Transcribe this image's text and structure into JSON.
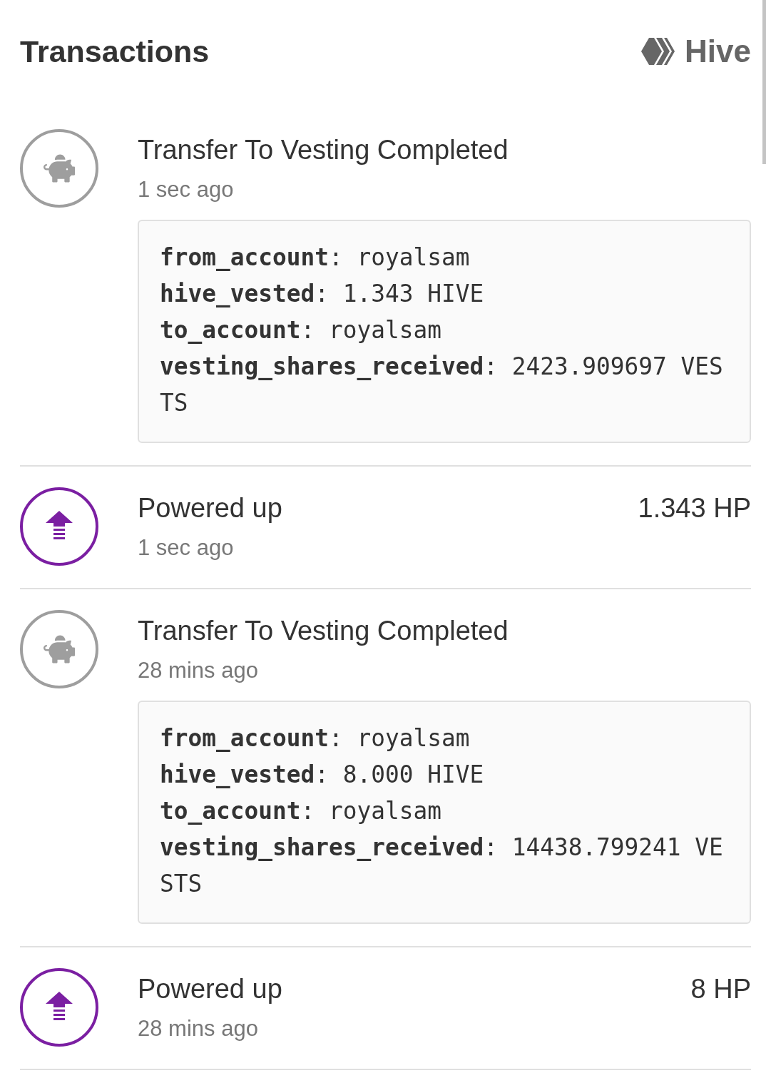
{
  "header": {
    "title": "Transactions",
    "brand": "Hive"
  },
  "transactions": [
    {
      "kind": "vesting",
      "title": "Transfer To Vesting Completed",
      "time": "1 sec ago",
      "details": [
        "**from_account**: royalsam",
        "**hive_vested**: 1.343 HIVE",
        "**to_account**: royalsam",
        "**vesting_shares_received**: 2423.909697 VESTS"
      ]
    },
    {
      "kind": "power_up",
      "title": "Powered up",
      "time": "1 sec ago",
      "amount": "1.343 HP"
    },
    {
      "kind": "vesting",
      "title": "Transfer To Vesting Completed",
      "time": "28 mins ago",
      "details": [
        "**from_account**: royalsam",
        "**hive_vested**: 8.000 HIVE",
        "**to_account**: royalsam",
        "**vesting_shares_received**: 14438.799241 VESTS"
      ]
    },
    {
      "kind": "power_up",
      "title": "Powered up",
      "time": "28 mins ago",
      "amount": "8 HP"
    }
  ]
}
